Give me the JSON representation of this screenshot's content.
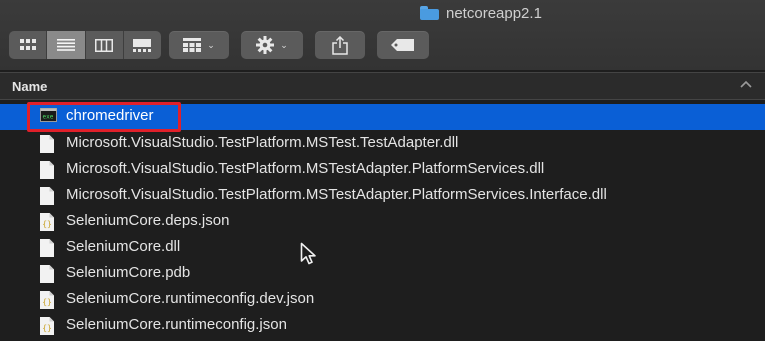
{
  "window": {
    "title": "netcoreapp2.1"
  },
  "toolbar": {
    "view_modes": [
      "icon-view",
      "list-view",
      "column-view",
      "gallery-view"
    ],
    "active_view": "list-view",
    "group_icon": "grid-group-icon",
    "action_icon": "gear-icon",
    "share_icon": "share-icon",
    "tag_icon": "tag-icon"
  },
  "list": {
    "column_header": "Name",
    "sort_icon": "chevron-up-icon",
    "items": [
      {
        "name": "chromedriver",
        "icon": "terminal-executable-icon",
        "selected": true
      },
      {
        "name": "Microsoft.VisualStudio.TestPlatform.MSTest.TestAdapter.dll",
        "icon": "document-icon"
      },
      {
        "name": "Microsoft.VisualStudio.TestPlatform.MSTestAdapter.PlatformServices.dll",
        "icon": "document-icon"
      },
      {
        "name": "Microsoft.VisualStudio.TestPlatform.MSTestAdapter.PlatformServices.Interface.dll",
        "icon": "document-icon"
      },
      {
        "name": "SeleniumCore.deps.json",
        "icon": "json-file-icon"
      },
      {
        "name": "SeleniumCore.dll",
        "icon": "document-icon"
      },
      {
        "name": "SeleniumCore.pdb",
        "icon": "document-icon"
      },
      {
        "name": "SeleniumCore.runtimeconfig.dev.json",
        "icon": "json-file-icon"
      },
      {
        "name": "SeleniumCore.runtimeconfig.json",
        "icon": "json-file-icon"
      }
    ]
  },
  "colors": {
    "selection": "#0a5fd6",
    "annotation_box": "#e0202a",
    "background": "#1e1e1e"
  }
}
